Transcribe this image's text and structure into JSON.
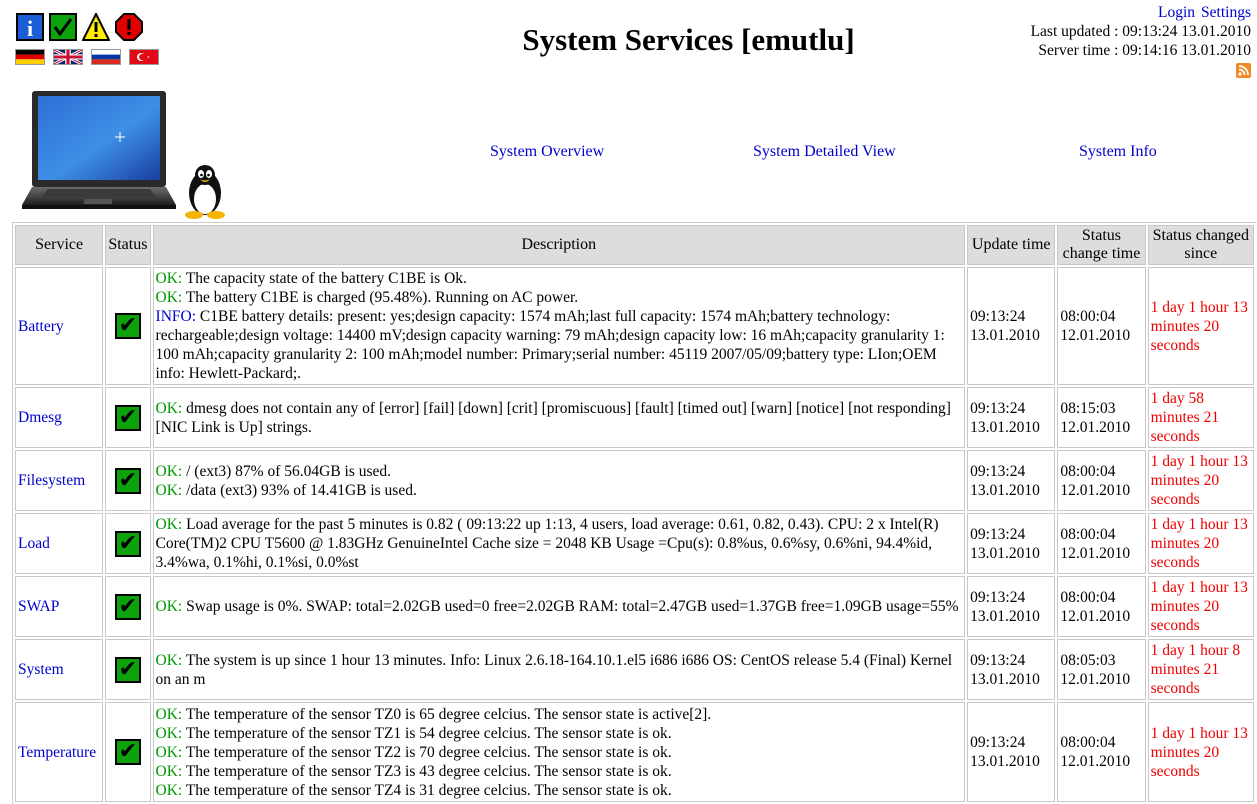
{
  "header": {
    "title": "System Services [emutlu]",
    "login_label": "Login",
    "settings_label": "Settings",
    "last_updated": "Last updated : 09:13:24 13.01.2010",
    "server_time": "Server time : 09:14:16 13.01.2010"
  },
  "status_icons": [
    "info-icon",
    "ok-check-icon",
    "warning-icon",
    "error-icon"
  ],
  "flags": [
    "flag-german-icon",
    "flag-uk-icon",
    "flag-russian-icon",
    "flag-turkish-icon"
  ],
  "nav": {
    "overview": "System Overview",
    "detailed": "System Detailed View",
    "info": "System Info"
  },
  "table": {
    "headers": {
      "service": "Service",
      "status": "Status",
      "description": "Description",
      "update_time": "Update time",
      "status_change_time": "Status change time",
      "status_changed_since": "Status changed since"
    },
    "rows": [
      {
        "service": "Battery",
        "lines": [
          {
            "tag": "OK:",
            "text": " The capacity state of the battery C1BE is Ok."
          },
          {
            "tag": "OK:",
            "text": " The battery C1BE is charged (95.48%). Running on AC power."
          },
          {
            "tag": "INFO:",
            "text": " C1BE battery details: present: yes;design capacity: 1574 mAh;last full capacity: 1574 mAh;battery technology: rechargeable;design voltage: 14400 mV;design capacity warning: 79 mAh;design capacity low: 16 mAh;capacity granularity 1: 100 mAh;capacity granularity 2: 100 mAh;model number: Primary;serial number: 45119 2007/05/09;battery type: LIon;OEM info: Hewlett-Packard;."
          }
        ],
        "update_time": [
          "09:13:24",
          "13.01.2010"
        ],
        "change_time": [
          "08:00:04",
          "12.01.2010"
        ],
        "since": "1 day 1 hour 13 minutes 20 seconds"
      },
      {
        "service": "Dmesg",
        "lines": [
          {
            "tag": "OK:",
            "text": " dmesg does not contain any of [error] [fail] [down] [crit] [promiscuous] [fault] [timed out] [warn] [notice] [not responding] [NIC Link is Up] strings."
          }
        ],
        "update_time": [
          "09:13:24",
          "13.01.2010"
        ],
        "change_time": [
          "08:15:03",
          "12.01.2010"
        ],
        "since": "1 day 58 minutes 21 seconds"
      },
      {
        "service": "Filesystem",
        "lines": [
          {
            "tag": "OK:",
            "text": " / (ext3) 87% of 56.04GB is used."
          },
          {
            "tag": "OK:",
            "text": " /data (ext3) 93% of 14.41GB is used."
          }
        ],
        "update_time": [
          "09:13:24",
          "13.01.2010"
        ],
        "change_time": [
          "08:00:04",
          "12.01.2010"
        ],
        "since": "1 day 1 hour 13 minutes 20 seconds"
      },
      {
        "service": "Load",
        "lines": [
          {
            "tag": "OK:",
            "text": " Load average for the past 5 minutes is 0.82 ( 09:13:22 up 1:13, 4 users, load average: 0.61, 0.82, 0.43). CPU: 2 x Intel(R) Core(TM)2 CPU T5600 @ 1.83GHz GenuineIntel Cache size = 2048 KB Usage =Cpu(s): 0.8%us, 0.6%sy, 0.6%ni, 94.4%id, 3.4%wa, 0.1%hi, 0.1%si, 0.0%st"
          }
        ],
        "update_time": [
          "09:13:24",
          "13.01.2010"
        ],
        "change_time": [
          "08:00:04",
          "12.01.2010"
        ],
        "since": "1 day 1 hour 13 minutes 20 seconds"
      },
      {
        "service": "SWAP",
        "lines": [
          {
            "tag": "OK:",
            "text": " Swap usage is 0%. SWAP: total=2.02GB used=0 free=2.02GB RAM: total=2.47GB used=1.37GB free=1.09GB usage=55%"
          }
        ],
        "update_time": [
          "09:13:24",
          "13.01.2010"
        ],
        "change_time": [
          "08:00:04",
          "12.01.2010"
        ],
        "since": "1 day 1 hour 13 minutes 20 seconds"
      },
      {
        "service": "System",
        "lines": [
          {
            "tag": "OK:",
            "text": " The system is up since 1 hour 13 minutes. Info: Linux 2.6.18-164.10.1.el5 i686 i686 OS: CentOS release 5.4 (Final) Kernel on an m"
          }
        ],
        "update_time": [
          "09:13:24",
          "13.01.2010"
        ],
        "change_time": [
          "08:05:03",
          "12.01.2010"
        ],
        "since": "1 day 1 hour 8 minutes 21 seconds"
      },
      {
        "service": "Temperature",
        "lines": [
          {
            "tag": "OK:",
            "text": " The temperature of the sensor TZ0 is 65 degree celcius. The sensor state is active[2]."
          },
          {
            "tag": "OK:",
            "text": " The temperature of the sensor TZ1 is 54 degree celcius. The sensor state is ok."
          },
          {
            "tag": "OK:",
            "text": " The temperature of the sensor TZ2 is 70 degree celcius. The sensor state is ok."
          },
          {
            "tag": "OK:",
            "text": " The temperature of the sensor TZ3 is 43 degree celcius. The sensor state is ok."
          },
          {
            "tag": "OK:",
            "text": " The temperature of the sensor TZ4 is 31 degree celcius. The sensor state is ok."
          }
        ],
        "update_time": [
          "09:13:24",
          "13.01.2010"
        ],
        "change_time": [
          "08:00:04",
          "12.01.2010"
        ],
        "since": "1 day 1 hour 13 minutes 20 seconds"
      }
    ]
  },
  "colors": {
    "ok": "#009900",
    "info": "#0000cc",
    "since": "#ee0000",
    "link": "#0000cc",
    "header_bg": "#dddddd",
    "status_ok": "#0ba20b"
  }
}
